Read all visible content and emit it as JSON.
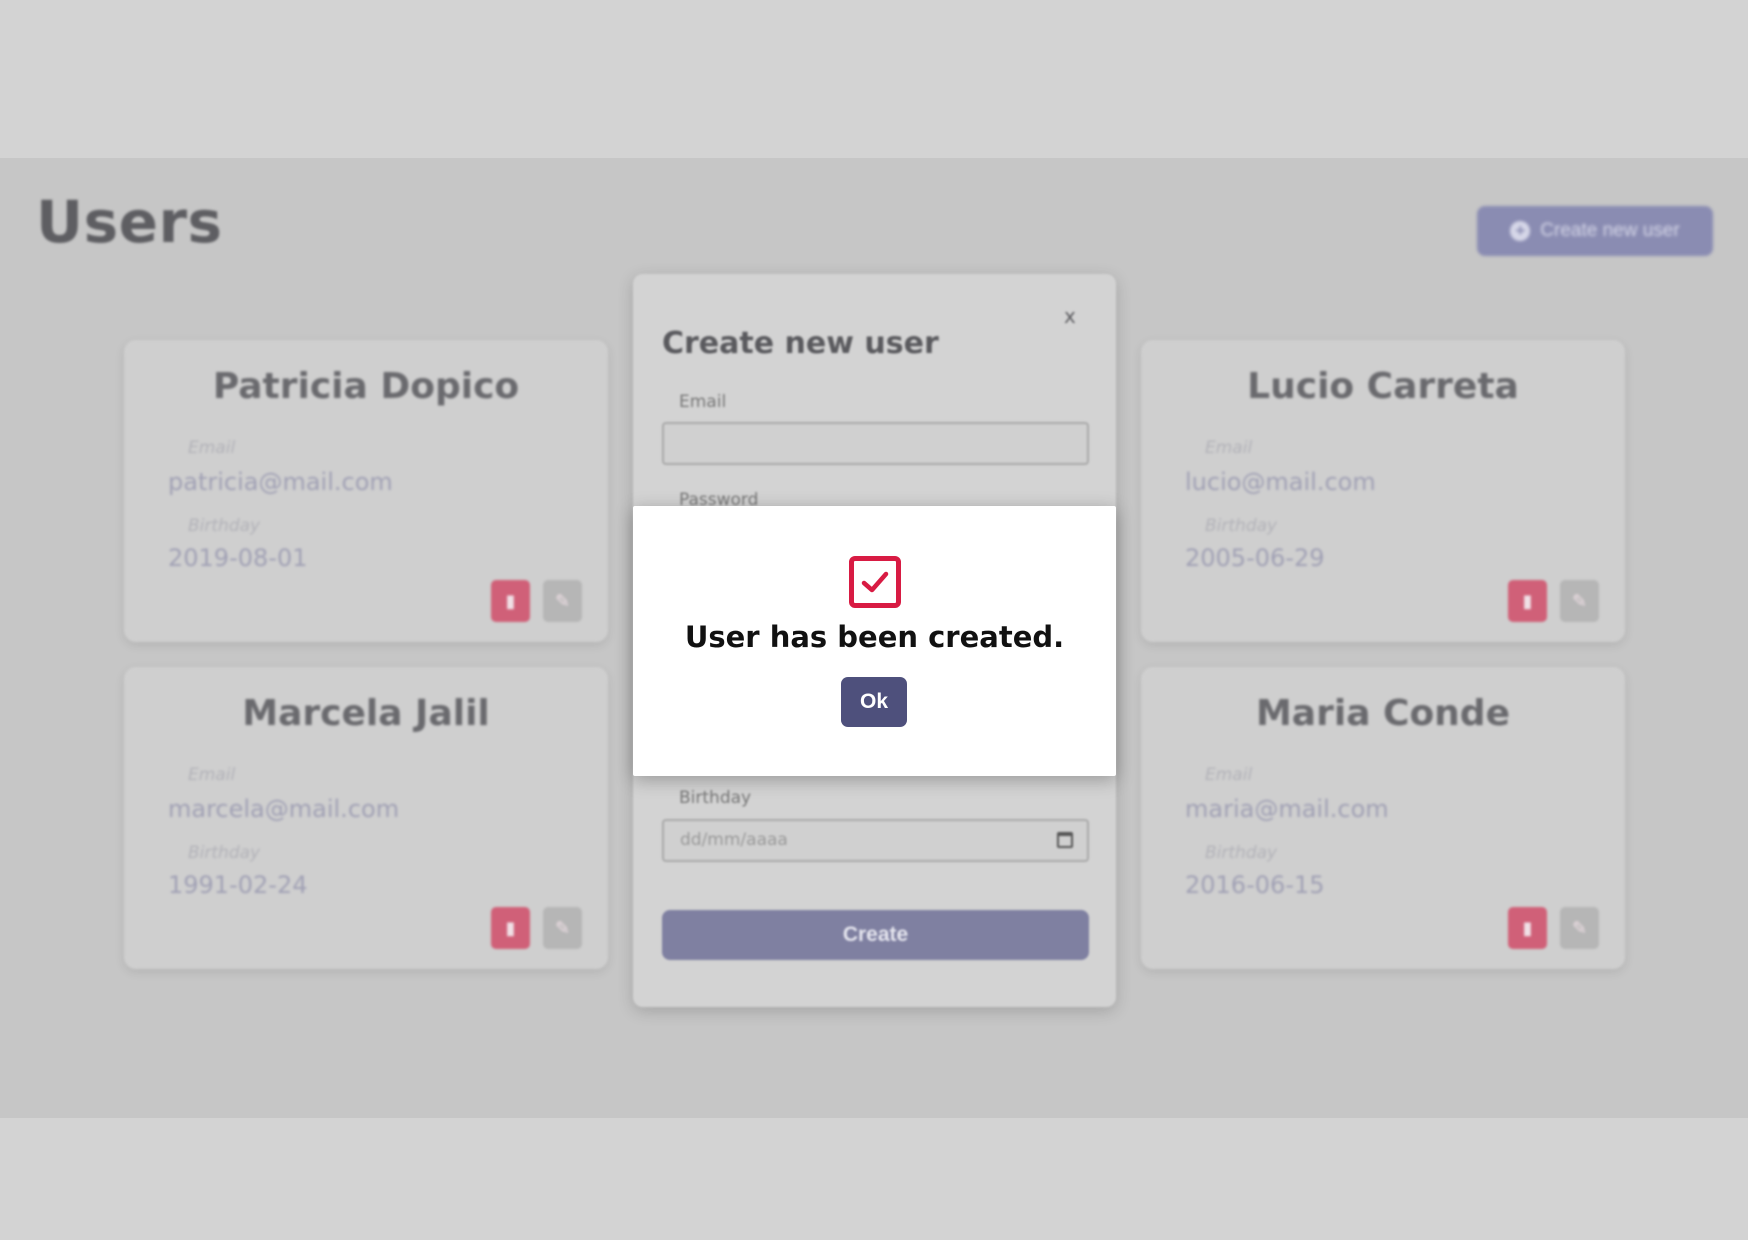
{
  "page": {
    "title": "Users"
  },
  "header": {
    "create_button_label": "Create new user",
    "create_button_icon": "plus-circle-icon"
  },
  "users": [
    {
      "name": "Patricia Dopico",
      "email_label": "Email",
      "email": "patricia@mail.com",
      "birthday_label": "Birthday",
      "birthday": "2019-08-01"
    },
    {
      "name": "Lucio Carreta",
      "email_label": "Email",
      "email": "lucio@mail.com",
      "birthday_label": "Birthday",
      "birthday": "2005-06-29"
    },
    {
      "name": "Marcela Jalil",
      "email_label": "Email",
      "email": "marcela@mail.com",
      "birthday_label": "Birthday",
      "birthday": "1991-02-24"
    },
    {
      "name": "Maria Conde",
      "email_label": "Email",
      "email": "maria@mail.com",
      "birthday_label": "Birthday",
      "birthday": "2016-06-15"
    }
  ],
  "create_modal": {
    "close_label": "x",
    "title": "Create new user",
    "email_label": "Email",
    "email_value": "",
    "password_label": "Password",
    "birthday_label": "Birthday",
    "birthday_placeholder": "dd/mm/aaaa",
    "submit_label": "Create"
  },
  "success_dialog": {
    "icon": "checkbox-checked-icon",
    "message": "User has been created.",
    "ok_label": "Ok",
    "accent_color": "#d81b43",
    "button_color": "#4e507c"
  }
}
